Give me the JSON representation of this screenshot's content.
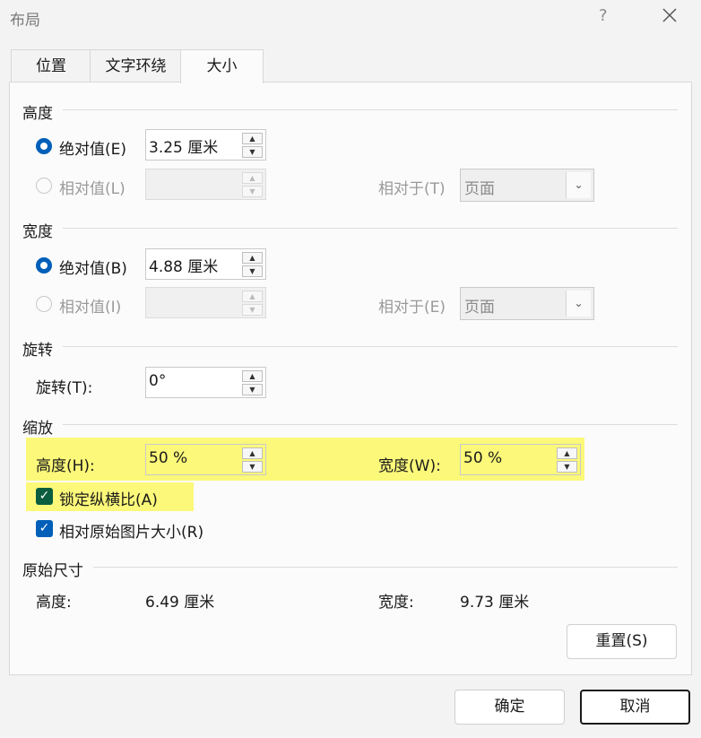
{
  "window": {
    "title": "布局",
    "help": "?"
  },
  "tabs": [
    {
      "label": "位置",
      "active": false
    },
    {
      "label": "文字环绕",
      "active": false
    },
    {
      "label": "大小",
      "active": true
    }
  ],
  "height": {
    "section": "高度",
    "absolute_label": "绝对值(E)",
    "absolute_value": "3.25 厘米",
    "relative_label": "相对值(L)",
    "relative_value": "",
    "relative_to_label": "相对于(T)",
    "relative_to_value": "页面"
  },
  "width": {
    "section": "宽度",
    "absolute_label": "绝对值(B)",
    "absolute_value": "4.88 厘米",
    "relative_label": "相对值(I)",
    "relative_value": "",
    "relative_to_label": "相对于(E)",
    "relative_to_value": "页面"
  },
  "rotation": {
    "section": "旋转",
    "label": "旋转(T):",
    "value": "0°"
  },
  "scale": {
    "section": "缩放",
    "height_label": "高度(H):",
    "height_value": "50 %",
    "width_label": "宽度(W):",
    "width_value": "50 %",
    "lock_aspect_label": "锁定纵横比(A)",
    "lock_aspect_checked": true,
    "relative_original_label": "相对原始图片大小(R)",
    "relative_original_checked": true
  },
  "original": {
    "section": "原始尺寸",
    "height_label": "高度:",
    "height_value": "6.49 厘米",
    "width_label": "宽度:",
    "width_value": "9.73 厘米",
    "reset_label": "重置(S)"
  },
  "footer": {
    "ok_label": "确定",
    "cancel_label": "取消"
  },
  "colors": {
    "accent": "#005fb8",
    "highlight": "#fbf87a"
  }
}
